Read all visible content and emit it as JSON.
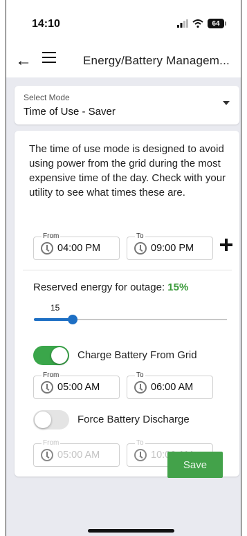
{
  "status": {
    "time": "14:10",
    "battery": "64"
  },
  "appbar": {
    "title": "Energy/Battery Managem..."
  },
  "mode": {
    "label": "Select Mode",
    "value": "Time of Use - Saver"
  },
  "description": "The time of use mode is designed to avoid using power from the grid during the most expensive time of the day. Check with your utility to see what times these are.",
  "schedule": {
    "from_label": "From",
    "from_value": "04:00 PM",
    "to_label": "To",
    "to_value": "09:00 PM"
  },
  "reserve": {
    "label": "Reserved energy for outage:",
    "percent_text": "15%",
    "slider_value": "15",
    "level_percent": 15
  },
  "charge_from_grid": {
    "label": "Charge Battery From Grid",
    "enabled": true,
    "from_label": "From",
    "from_value": "05:00 AM",
    "to_label": "To",
    "to_value": "06:00 AM"
  },
  "force_discharge": {
    "label": "Force Battery Discharge",
    "enabled": false,
    "from_label": "From",
    "from_value": "05:00 AM",
    "to_label": "To",
    "to_value": "10:00 AM"
  },
  "actions": {
    "save_label": "Save"
  },
  "colors": {
    "accent_green": "#43a24a",
    "toggle_green": "#3aa64a",
    "slider_blue": "#1e6fc4",
    "background": "#e9eaf0"
  }
}
